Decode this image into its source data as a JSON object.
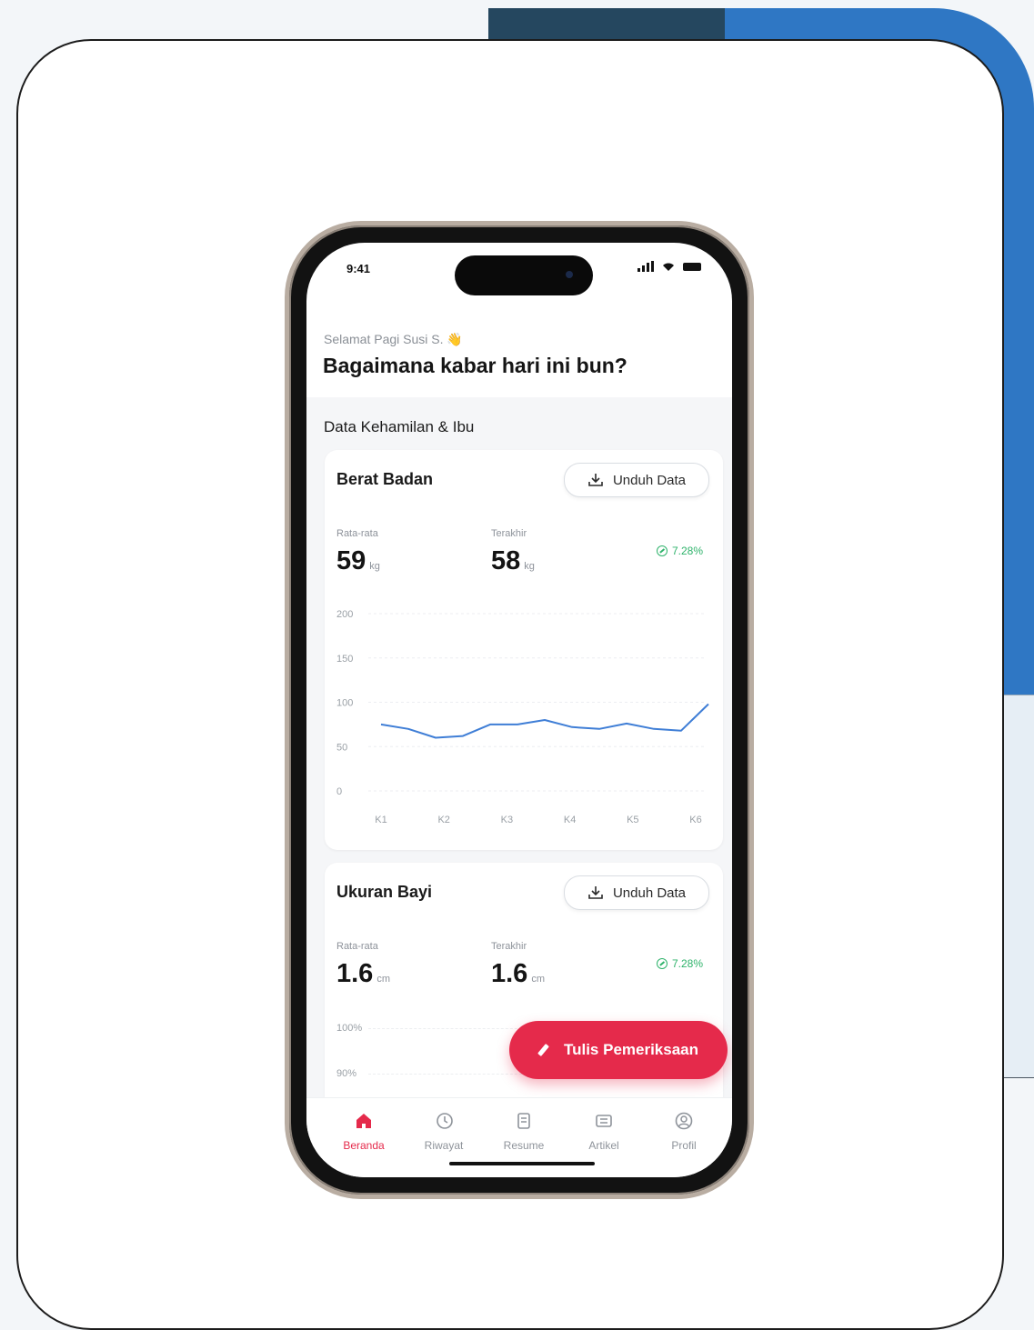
{
  "status_bar": {
    "time": "9:41"
  },
  "header": {
    "greeting": "Selamat Pagi Susi S.",
    "wave_emoji": "👋",
    "question": "Bagaimana kabar hari ini bun?"
  },
  "section": {
    "title": "Data Kehamilan & Ibu"
  },
  "weight_card": {
    "title": "Berat Badan",
    "download_label": "Unduh Data",
    "avg_label": "Rata-rata",
    "avg_value": "59",
    "avg_unit": "kg",
    "last_label": "Terakhir",
    "last_value": "58",
    "last_unit": "kg",
    "trend": "7.28%"
  },
  "chart_data": {
    "type": "line",
    "x": [
      "K1",
      "K2",
      "K3",
      "K4",
      "K5",
      "K6"
    ],
    "yticks": [
      "200",
      "150",
      "100",
      "50",
      "0"
    ],
    "ylim": [
      0,
      200
    ],
    "series": [
      {
        "values": [
          75,
          70,
          60,
          62,
          75,
          75,
          80,
          72,
          70,
          76,
          70,
          68,
          98
        ]
      }
    ],
    "line_color": "#3f7ed6",
    "grid": true
  },
  "baby_card": {
    "title": "Ukuran Bayi",
    "download_label": "Unduh Data",
    "avg_label": "Rata-rata",
    "avg_value": "1.6",
    "avg_unit": "cm",
    "last_label": "Terakhir",
    "last_value": "1.6",
    "last_unit": "cm",
    "trend": "7.28%",
    "yticks": [
      "100%",
      "90%"
    ]
  },
  "fab": {
    "label": "Tulis Pemeriksaan"
  },
  "tabs": [
    {
      "label": "Beranda",
      "icon": "home-icon",
      "active": true
    },
    {
      "label": "Riwayat",
      "icon": "history-icon",
      "active": false
    },
    {
      "label": "Resume",
      "icon": "document-icon",
      "active": false
    },
    {
      "label": "Artikel",
      "icon": "article-icon",
      "active": false
    },
    {
      "label": "Profil",
      "icon": "profile-icon",
      "active": false
    }
  ],
  "colors": {
    "accent": "#e52a4b",
    "positive": "#2fb36b",
    "brand_blue": "#2f77c4"
  }
}
